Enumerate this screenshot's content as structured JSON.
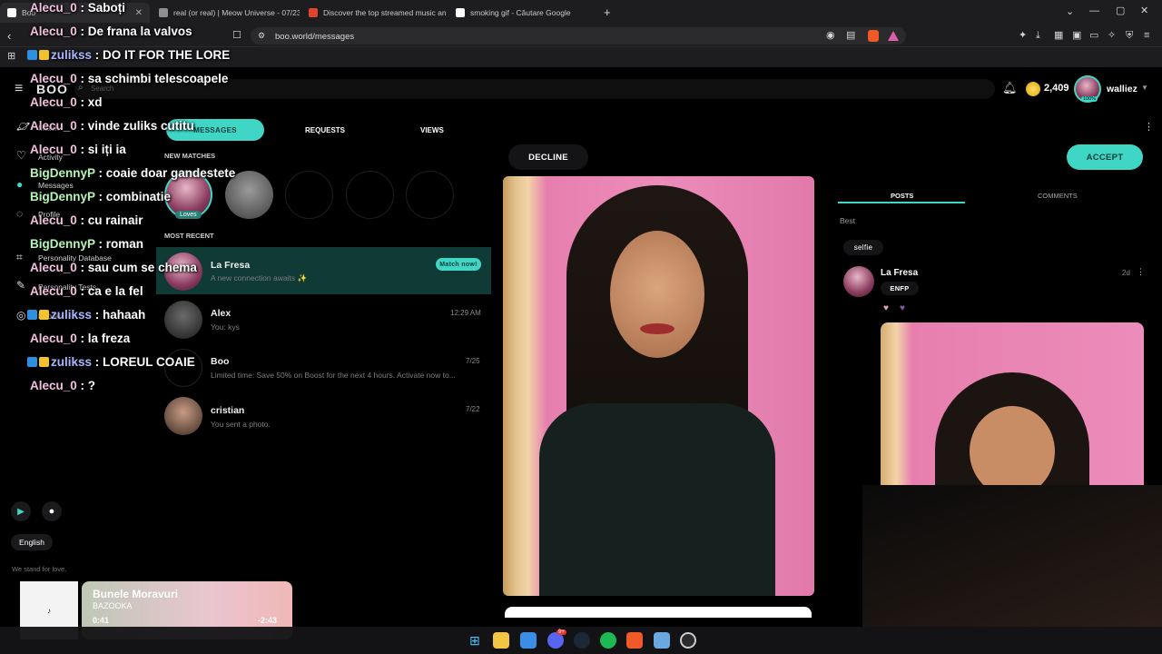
{
  "browser": {
    "tabs": [
      {
        "label": "Boo",
        "favicon_color": "#ffffff",
        "active": true
      },
      {
        "label": "real (or real) | Meow Universe - 07/23",
        "favicon_color": "#9a9a9a"
      },
      {
        "label": "Discover the top streamed music and",
        "favicon_color": "#e0452b"
      },
      {
        "label": "smoking gif - Căutare Google",
        "favicon_color": "#ffffff"
      }
    ],
    "new_tab": "+",
    "url": "boo.world/messages",
    "window_controls": [
      "chevron-down-icon",
      "minimize-icon",
      "maximize-icon",
      "close-icon"
    ]
  },
  "header": {
    "logo": "BOO",
    "search_placeholder": "Search",
    "coins": "2,409",
    "username": "walliez",
    "avatar_badge": "100%"
  },
  "sidebar": {
    "items": [
      {
        "label": "Match",
        "icon": "planet-icon"
      },
      {
        "label": "Activity",
        "icon": "heart-icon"
      },
      {
        "label": "Messages",
        "icon": "chat-icon"
      },
      {
        "label": "Profile",
        "icon": "bell-icon"
      },
      {
        "label": "Personality Database",
        "icon": "grid-icon"
      },
      {
        "label": "Personality Tests",
        "icon": "test-icon"
      },
      {
        "label": "Boo AI",
        "icon": "ai-icon"
      }
    ],
    "store_buttons": [
      "play-store-icon",
      "apple-icon"
    ],
    "language": "English",
    "footer_text": "We stand for love."
  },
  "messages_panel": {
    "tabs": [
      "MESSAGES",
      "REQUESTS",
      "VIEWS"
    ],
    "new_matches_title": "NEW MATCHES",
    "loves_badge": "Loves",
    "most_recent_title": "MOST RECENT",
    "conversations": [
      {
        "name": "La Fresa",
        "preview": "A new connection awaits ✨",
        "time": "",
        "badge": "Match now!"
      },
      {
        "name": "Alex",
        "preview": "You: kys",
        "time": "12:29 AM"
      },
      {
        "name": "Boo",
        "preview": "Limited time: Save 50% on Boost for the next 4 hours. Activate now to...",
        "time": "7/25"
      },
      {
        "name": "cristian",
        "preview": "You sent a photo.",
        "time": "7/22"
      }
    ]
  },
  "profile_view": {
    "decline_label": "DECLINE",
    "accept_label": "ACCEPT",
    "tabs": [
      "POSTS",
      "COMMENTS"
    ],
    "sort": "Best",
    "tag": "selfie",
    "post_author": "La Fresa",
    "post_time": "2d",
    "mbti": "ENFP"
  },
  "chat_overlay": [
    {
      "user": "Alecu_0",
      "msg": "Saboți",
      "cls": "u-alecu"
    },
    {
      "user": "Alecu_0",
      "msg": "De frana la valvos",
      "cls": "u-alecu"
    },
    {
      "user": "zulikss",
      "msg": "DO IT FOR THE LORE",
      "cls": "u-zul",
      "badges": true
    },
    {
      "user": "Alecu_0",
      "msg": "sa schimbi telescoapele",
      "cls": "u-alecu"
    },
    {
      "user": "Alecu_0",
      "msg": "xd",
      "cls": "u-alecu"
    },
    {
      "user": "Alecu_0",
      "msg": "vinde zuliks cutitu",
      "cls": "u-alecu"
    },
    {
      "user": "Alecu_0",
      "msg": "si iți ia",
      "cls": "u-alecu"
    },
    {
      "user": "BigDennyP",
      "msg": "coaie doar gandestete",
      "cls": "u-big"
    },
    {
      "user": "BigDennyP",
      "msg": "combinatie",
      "cls": "u-big"
    },
    {
      "user": "Alecu_0",
      "msg": "cu rainair",
      "cls": "u-alecu"
    },
    {
      "user": "BigDennyP",
      "msg": "roman",
      "cls": "u-big"
    },
    {
      "user": "Alecu_0",
      "msg": "sau cum se chema",
      "cls": "u-alecu"
    },
    {
      "user": "Alecu_0",
      "msg": "ca e la fel",
      "cls": "u-alecu"
    },
    {
      "user": "zulikss",
      "msg": "hahaah",
      "cls": "u-zul",
      "badges": true
    },
    {
      "user": "Alecu_0",
      "msg": "la freza",
      "cls": "u-alecu"
    },
    {
      "user": "zulikss",
      "msg": "LOREUL COAIE",
      "cls": "u-zul",
      "badges": true
    },
    {
      "user": "Alecu_0",
      "msg": "?",
      "cls": "u-alecu"
    }
  ],
  "now_playing": {
    "title": "Bunele Moravuri",
    "artist": "BAZOOKA",
    "elapsed": "0:41",
    "remaining": "-2:43",
    "progress": 0.2
  },
  "taskbar": {
    "apps": [
      "windows-icon",
      "folder-icon",
      "photos-icon",
      "discord-icon",
      "steam-icon",
      "spotify-icon",
      "brave-icon",
      "mail-icon",
      "obs-icon"
    ],
    "discord_badge": "9+"
  },
  "colors": {
    "accent": "#3fd6c6",
    "bg": "#000000",
    "chrome": "#1d1d1f"
  }
}
